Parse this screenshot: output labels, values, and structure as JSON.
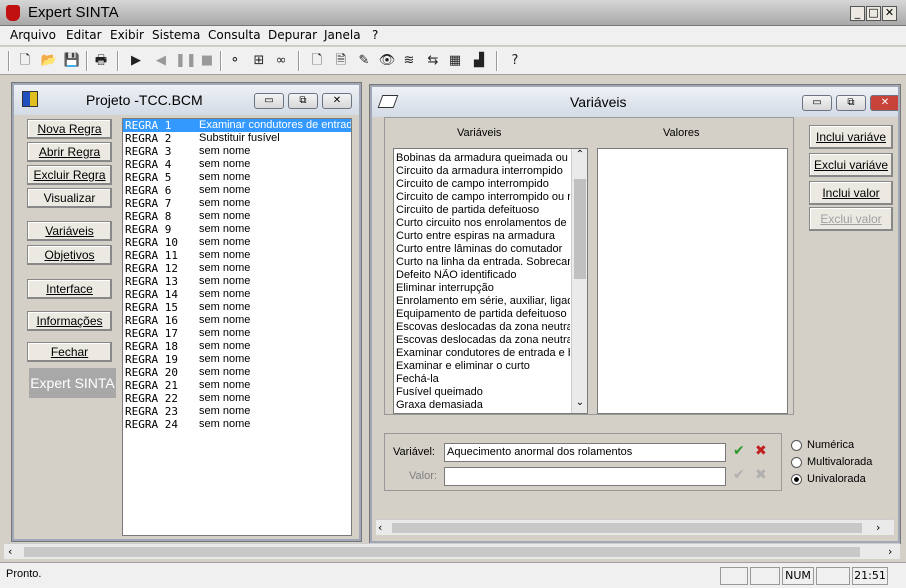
{
  "app": {
    "title": "Expert SINTA"
  },
  "menu": [
    "Arquivo",
    "Editar",
    "Exibir",
    "Sistema",
    "Consulta",
    "Depurar",
    "Janela",
    "?"
  ],
  "toolbar_icons": [
    "new-file-icon",
    "open-folder-icon",
    "save-icon",
    "print-icon",
    "run-icon",
    "step-back-icon",
    "pause-icon",
    "stop-icon",
    "trace-icon",
    "expand-icon",
    "glasses-icon",
    "doc-icon",
    "doc-lines-icon",
    "folder-edit-icon",
    "eye-icon",
    "stack-icon",
    "flow-icon",
    "calculator-icon",
    "chart-icon",
    "help-icon"
  ],
  "project": {
    "title": "Projeto -TCC.BCM",
    "buttons": {
      "nova": "Nova Regra",
      "abrir": "Abrir Regra",
      "excluir": "Excluir Regra",
      "visualizar": "Visualizar",
      "variaveis": "Variáveis",
      "objetivos": "Objetivos",
      "interface": "Interface",
      "informacoes": "Informações",
      "fechar": "Fechar"
    },
    "logo": "Expert SINTA",
    "rules": [
      {
        "id": "REGRA 1",
        "name": "Examinar condutores de entrada"
      },
      {
        "id": "REGRA 2",
        "name": "Substituir fusível"
      },
      {
        "id": "REGRA 3",
        "name": "sem nome"
      },
      {
        "id": "REGRA 4",
        "name": "sem nome"
      },
      {
        "id": "REGRA 5",
        "name": "sem nome"
      },
      {
        "id": "REGRA 6",
        "name": "sem nome"
      },
      {
        "id": "REGRA 7",
        "name": "sem nome"
      },
      {
        "id": "REGRA 8",
        "name": "sem nome"
      },
      {
        "id": "REGRA 9",
        "name": "sem nome"
      },
      {
        "id": "REGRA 10",
        "name": "sem nome"
      },
      {
        "id": "REGRA 11",
        "name": "sem nome"
      },
      {
        "id": "REGRA 12",
        "name": "sem nome"
      },
      {
        "id": "REGRA 13",
        "name": "sem nome"
      },
      {
        "id": "REGRA 14",
        "name": "sem nome"
      },
      {
        "id": "REGRA 15",
        "name": "sem nome"
      },
      {
        "id": "REGRA 16",
        "name": "sem nome"
      },
      {
        "id": "REGRA 17",
        "name": "sem nome"
      },
      {
        "id": "REGRA 18",
        "name": "sem nome"
      },
      {
        "id": "REGRA 19",
        "name": "sem nome"
      },
      {
        "id": "REGRA 20",
        "name": "sem nome"
      },
      {
        "id": "REGRA 21",
        "name": "sem nome"
      },
      {
        "id": "REGRA 22",
        "name": "sem nome"
      },
      {
        "id": "REGRA 23",
        "name": "sem nome"
      },
      {
        "id": "REGRA 24",
        "name": "sem nome"
      }
    ]
  },
  "variables": {
    "title": "Variáveis",
    "col_vars": "Variáveis",
    "col_vals": "Valores",
    "items": [
      "Bobinas da armadura queimada ou e",
      "Circuito da armadura interrompido",
      "Circuito de campo interrompido",
      "Circuito de campo interrompido ou re",
      "Circuito de partida defeituoso",
      "Curto circuito nos enrolamentos de a",
      "Curto entre espiras na armadura",
      "Curto entre lâminas do comutador",
      "Curto na linha da entrada. Sobrecarg",
      "Defeito NÃO identificado",
      "Eliminar interrupção",
      "Enrolamento em série, auxiliar, ligado",
      "Equipamento de partida defeituoso",
      "Escovas deslocadas da zona neutra",
      "Escovas deslocadas da zona neutra",
      "Examinar condutores de entrada e b",
      "Examinar e eliminar o curto",
      "Fechá-la",
      "Fusível queimado",
      "Graxa demasiada"
    ],
    "buttons": {
      "inclui_var": "Inclui variáve",
      "exclui_var": "Exclui variáve",
      "inclui_val": "Inclui valor",
      "exclui_val": "Exclui valor"
    },
    "label_var": "Variável:",
    "label_val": "Valor:",
    "var_value": "Aquecimento anormal dos rolamentos",
    "val_value": "",
    "types": [
      "Numérica",
      "Multivalorada",
      "Univalorada"
    ],
    "selected_type": "Univalorada"
  },
  "status": {
    "text": "Pronto.",
    "num": "NUM",
    "time": "21:51"
  }
}
